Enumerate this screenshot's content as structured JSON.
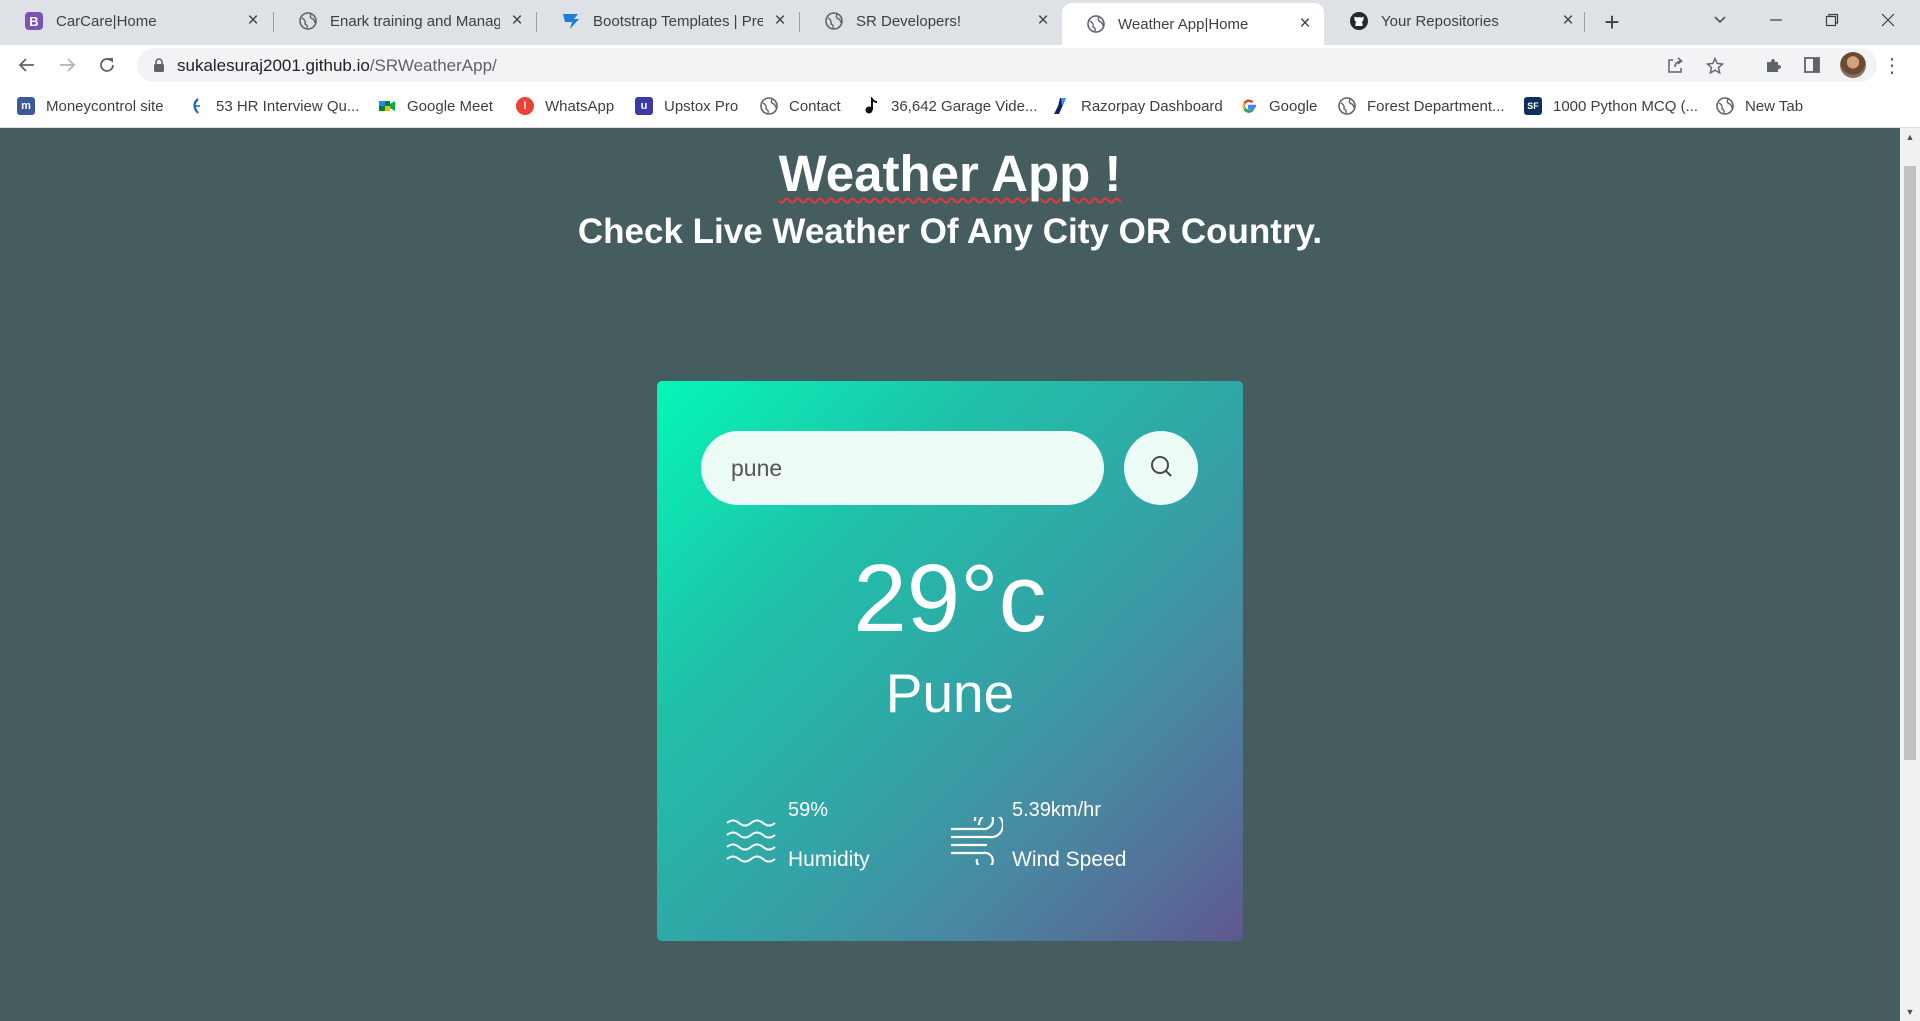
{
  "browser": {
    "tabs": [
      {
        "title": "CarCare|Home",
        "icon": "bootstrap-icon",
        "active": false
      },
      {
        "title": "Enark training and Management",
        "icon": "globe-icon",
        "active": false
      },
      {
        "title": "Bootstrap Templates | Premium",
        "icon": "bootstrapmade-icon",
        "active": false
      },
      {
        "title": "SR Developers!",
        "icon": "globe-icon",
        "active": false
      },
      {
        "title": "Weather App|Home",
        "icon": "globe-icon",
        "active": true
      },
      {
        "title": "Your Repositories",
        "icon": "github-icon",
        "active": false
      }
    ],
    "url_host": "sukalesuraj2001.github.io",
    "url_path": "/SRWeatherApp/",
    "bookmarks": [
      {
        "label": "Moneycontrol site",
        "icon": "moneycontrol-icon"
      },
      {
        "label": "53 HR Interview Qu...",
        "icon": "k-logo-icon"
      },
      {
        "label": "Google Meet",
        "icon": "google-meet-icon"
      },
      {
        "label": "WhatsApp",
        "icon": "alert-icon"
      },
      {
        "label": "Upstox Pro",
        "icon": "upstox-icon"
      },
      {
        "label": "Contact",
        "icon": "globe-icon"
      },
      {
        "label": "36,642 Garage Vide...",
        "icon": "music-note-icon"
      },
      {
        "label": "Razorpay Dashboard",
        "icon": "razorpay-icon"
      },
      {
        "label": "Google",
        "icon": "google-icon"
      },
      {
        "label": "Forest Department...",
        "icon": "globe-icon"
      },
      {
        "label": "1000 Python MCQ (...",
        "icon": "sf-icon"
      },
      {
        "label": "New Tab",
        "icon": "globe-icon"
      }
    ]
  },
  "page": {
    "heading": "Weather App !",
    "subheading": "Check Live Weather Of Any City OR Country.",
    "search": {
      "value": "pune",
      "icon": "search-icon"
    },
    "temperature": "29°c",
    "city": "Pune",
    "humidity": {
      "value": "59%",
      "label": "Humidity",
      "icon": "waves-icon"
    },
    "wind": {
      "value": "5.39km/hr",
      "label": "Wind Speed",
      "icon": "wind-icon"
    }
  },
  "colors": {
    "page_bg": "#455d5e",
    "card_gradient_start": "#05f7b9",
    "card_gradient_end": "#5f5890",
    "input_bg": "#edfbf6"
  }
}
